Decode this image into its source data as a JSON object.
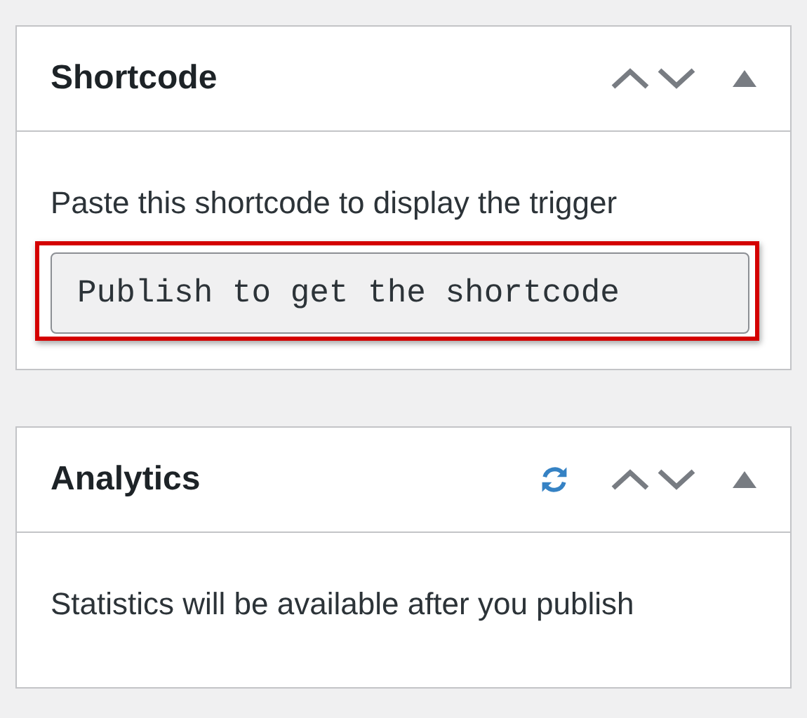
{
  "panels": [
    {
      "title": "Shortcode",
      "refreshable": false,
      "expanded": true,
      "content": [
        {
          "kind": "text",
          "text": "Paste this shortcode to display the trigger"
        },
        {
          "kind": "field",
          "value": "Publish to get the shortcode",
          "highlighted": true
        }
      ]
    },
    {
      "title": "Analytics",
      "refreshable": true,
      "expanded": true,
      "content": [
        {
          "kind": "text",
          "text": "Statistics will be available after you publish"
        }
      ]
    }
  ]
}
